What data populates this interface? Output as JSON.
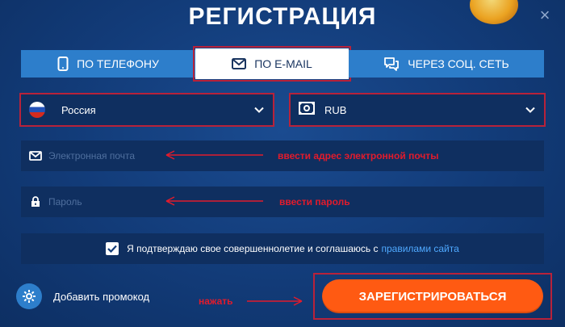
{
  "title": "РЕГИСТРАЦИЯ",
  "tabs": [
    {
      "label": "ПО ТЕЛЕФОНУ",
      "icon": "phone-icon"
    },
    {
      "label": "ПО E-MAIL",
      "icon": "mail-icon",
      "active": true
    },
    {
      "label": "ЧЕРЕЗ СОЦ. СЕТЬ",
      "icon": "chat-icon"
    }
  ],
  "country": {
    "value": "Россия",
    "icon": "russia-flag-icon"
  },
  "currency": {
    "value": "RUB",
    "icon": "banknote-icon"
  },
  "email": {
    "placeholder": "Электронная почта",
    "value": "",
    "annotation": "ввести адрес электронной почты"
  },
  "password": {
    "placeholder": "Пароль",
    "value": "",
    "annotation": "ввести пароль"
  },
  "agreement": {
    "text": "Я подтверждаю свое совершеннолетие и соглашаюсь с",
    "link": "правилами сайта",
    "checked": true
  },
  "promo": {
    "label": "Добавить промокод",
    "icon": "gear-icon"
  },
  "press_annotation": "нажать",
  "register": {
    "label": "ЗАРЕГИСТРИРОВАТЬСЯ"
  },
  "colors": {
    "background": "#123b78",
    "tab": "#2d7ecb",
    "field": "#0f2f60",
    "accent": "#ff5a12",
    "annotation": "#e21b2c",
    "link": "#4fa9ff"
  }
}
